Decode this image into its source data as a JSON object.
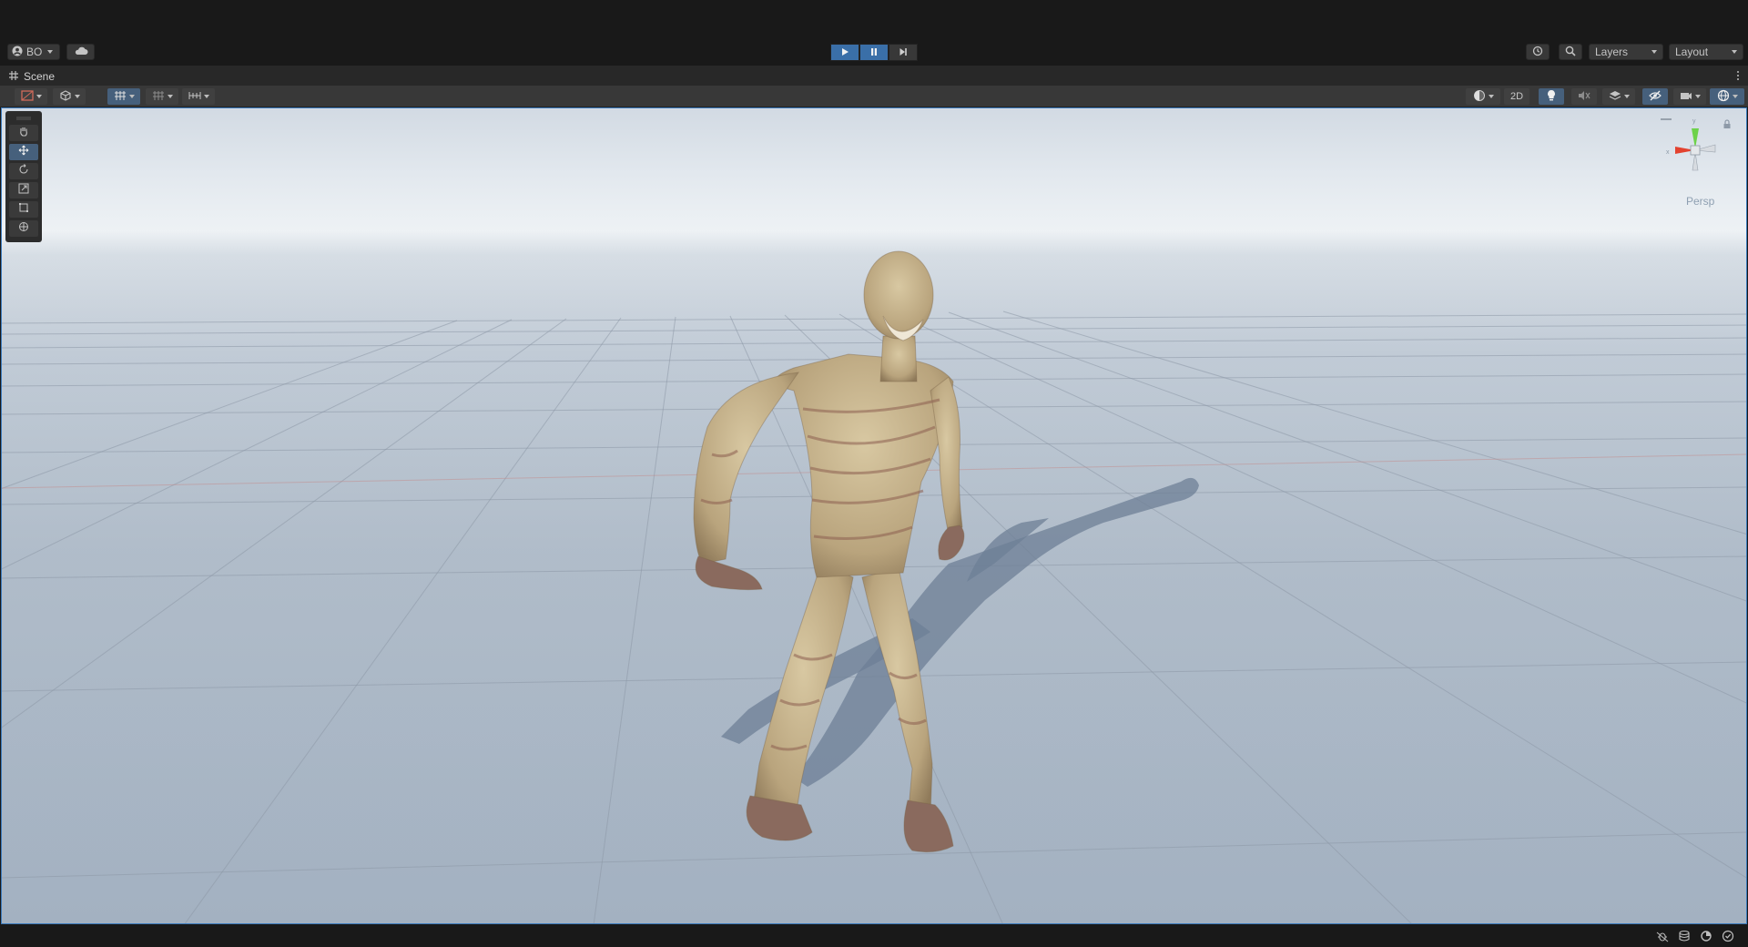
{
  "toolbar": {
    "account_label": "BO",
    "layers_label": "Layers",
    "layout_label": "Layout"
  },
  "scene_tab": {
    "title": "Scene"
  },
  "scene_toolbar": {
    "mode_2d_label": "2D"
  },
  "viewport": {
    "projection_label": "Persp",
    "model": "Mummy character (T-pose walking, bandaged)"
  },
  "colors": {
    "accent_blue": "#3a6fa8",
    "active_tool": "#46607c",
    "gizmo_y": "#6dd24a",
    "gizmo_x": "#e3422f",
    "viewport_border": "#3a79bb"
  }
}
